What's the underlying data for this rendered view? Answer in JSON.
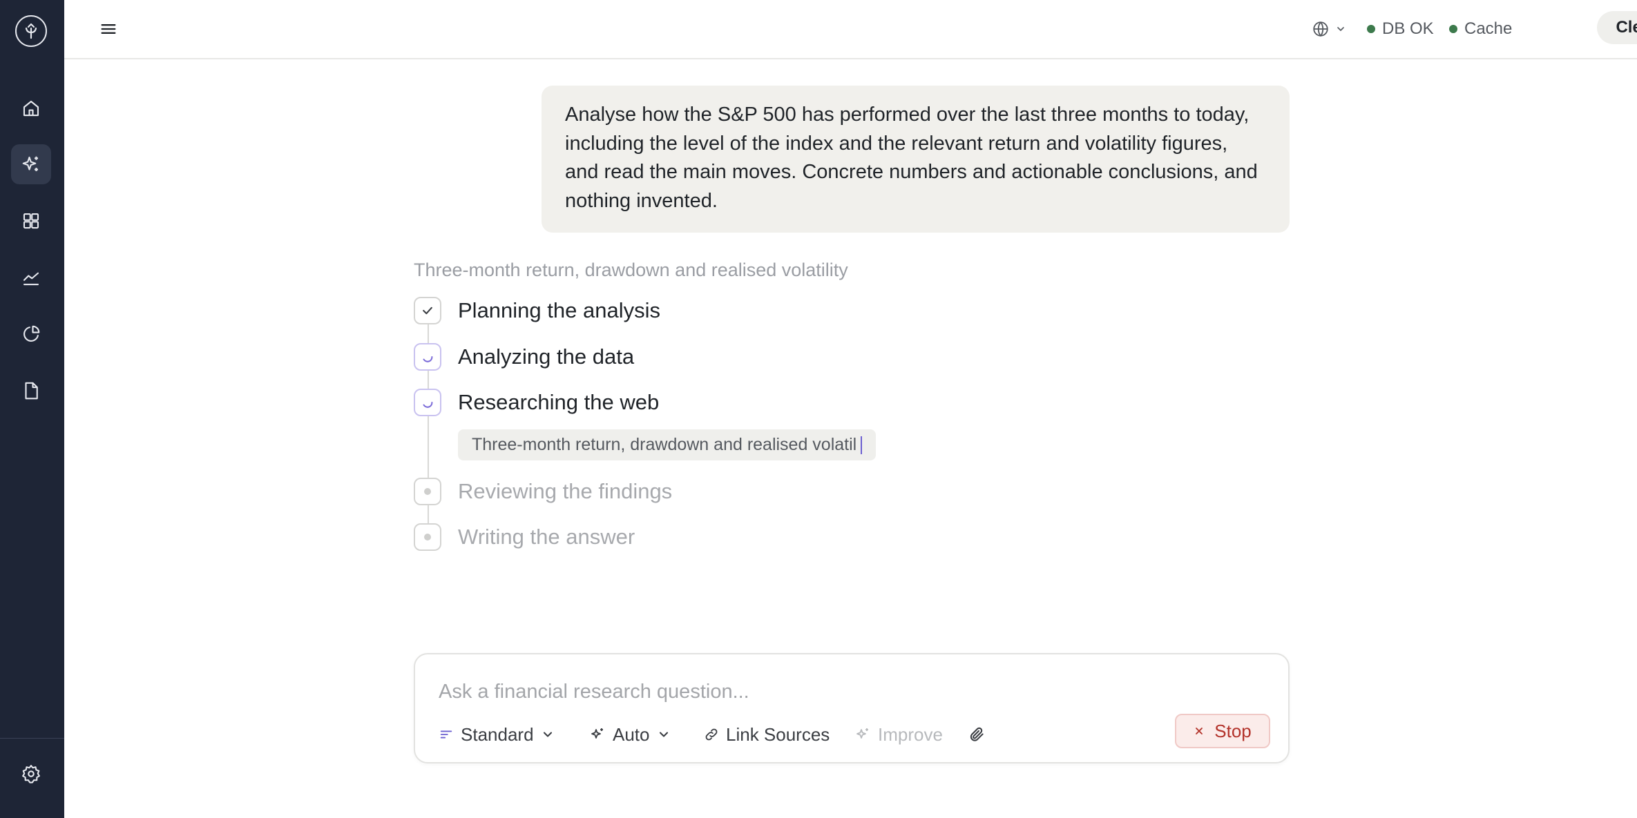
{
  "sidebar": {
    "items": [
      {
        "name": "home",
        "icon": "home-icon",
        "active": false
      },
      {
        "name": "research",
        "icon": "sparkles-icon",
        "active": true
      },
      {
        "name": "dashboard",
        "icon": "grid-icon",
        "active": false
      },
      {
        "name": "markets",
        "icon": "trend-icon",
        "active": false
      },
      {
        "name": "portfolio",
        "icon": "pie-chart-icon",
        "active": false
      },
      {
        "name": "documents",
        "icon": "document-icon",
        "active": false
      }
    ],
    "settings_icon": "gear-icon"
  },
  "topbar": {
    "db_status": "DB OK",
    "cache_status": "Cache",
    "clear_label": "Clear",
    "status_color": "#3d7a4c"
  },
  "conversation": {
    "user_message": "Analyse how the S&P 500 has performed over the last three months to today, including the level of the index and the relevant return and volatility figures, and read the main moves. Concrete numbers and actionable conclusions, and nothing invented."
  },
  "task": {
    "title": "Three-month return, drawdown and realised volatility",
    "steps": [
      {
        "label": "Planning the analysis",
        "state": "done"
      },
      {
        "label": "Analyzing the data",
        "state": "running"
      },
      {
        "label": "Researching the web",
        "state": "running"
      },
      {
        "label": "Reviewing the findings",
        "state": "pending"
      },
      {
        "label": "Writing the answer",
        "state": "pending"
      }
    ],
    "sub_query": "Three-month return, drawdown and realised volatil"
  },
  "composer": {
    "placeholder": "Ask a financial research question...",
    "mode_label": "Standard",
    "model_label": "Auto",
    "link_sources_label": "Link Sources",
    "improve_label": "Improve",
    "stop_label": "Stop",
    "accent_color": "#b3332b"
  }
}
